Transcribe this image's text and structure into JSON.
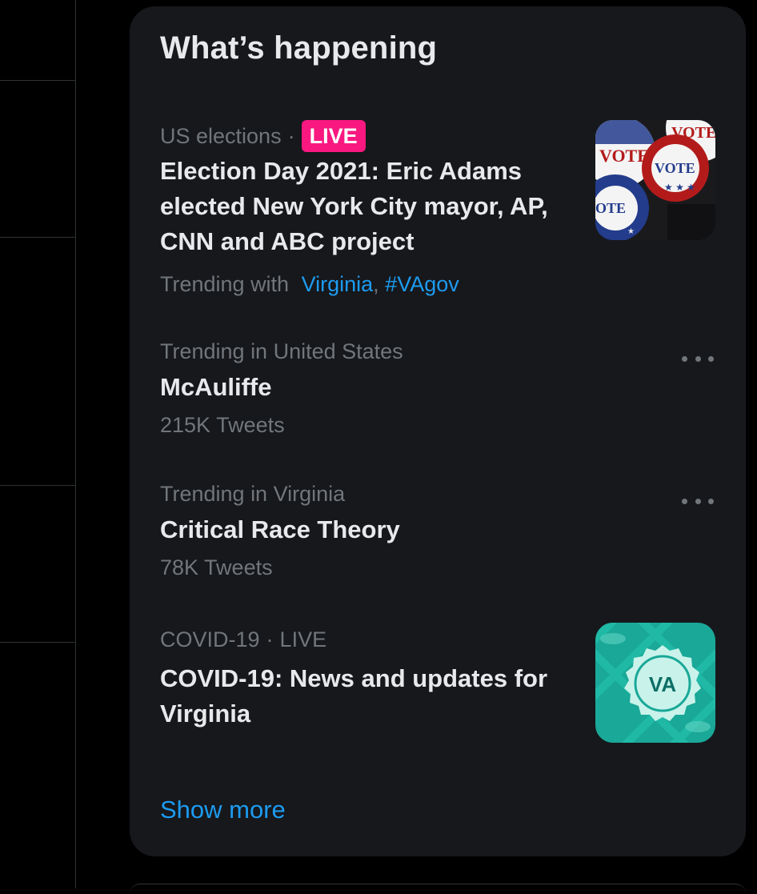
{
  "panel": {
    "title": "What’s happening"
  },
  "trends": [
    {
      "category": "US elections",
      "live_badge": "LIVE",
      "headline": "Election Day 2021: Eric Adams elected New York City mayor, AP, CNN and ABC project",
      "trending_with_label": "Trending with",
      "trending_with": [
        "Virginia",
        "#VAgov"
      ],
      "separator": ",",
      "thumbnail": "vote-buttons-image"
    },
    {
      "context": "Trending in United States",
      "name": "McAuliffe",
      "count": "215K Tweets",
      "more_icon": "more-horizontal-icon"
    },
    {
      "context": "Trending in Virginia",
      "name": "Critical Race Theory",
      "count": "78K Tweets",
      "more_icon": "more-horizontal-icon"
    },
    {
      "category": "COVID-19",
      "live_label": "LIVE",
      "headline": "COVID-19: News and updates for Virginia",
      "thumbnail": "va-badge-image",
      "thumbnail_text": "VA"
    }
  ],
  "show_more": "Show more",
  "colors": {
    "background": "#000000",
    "panel": "#16181c",
    "accent": "#1d9bf0",
    "live": "#f91880",
    "muted": "#71767b",
    "text": "#e7e9ea"
  }
}
